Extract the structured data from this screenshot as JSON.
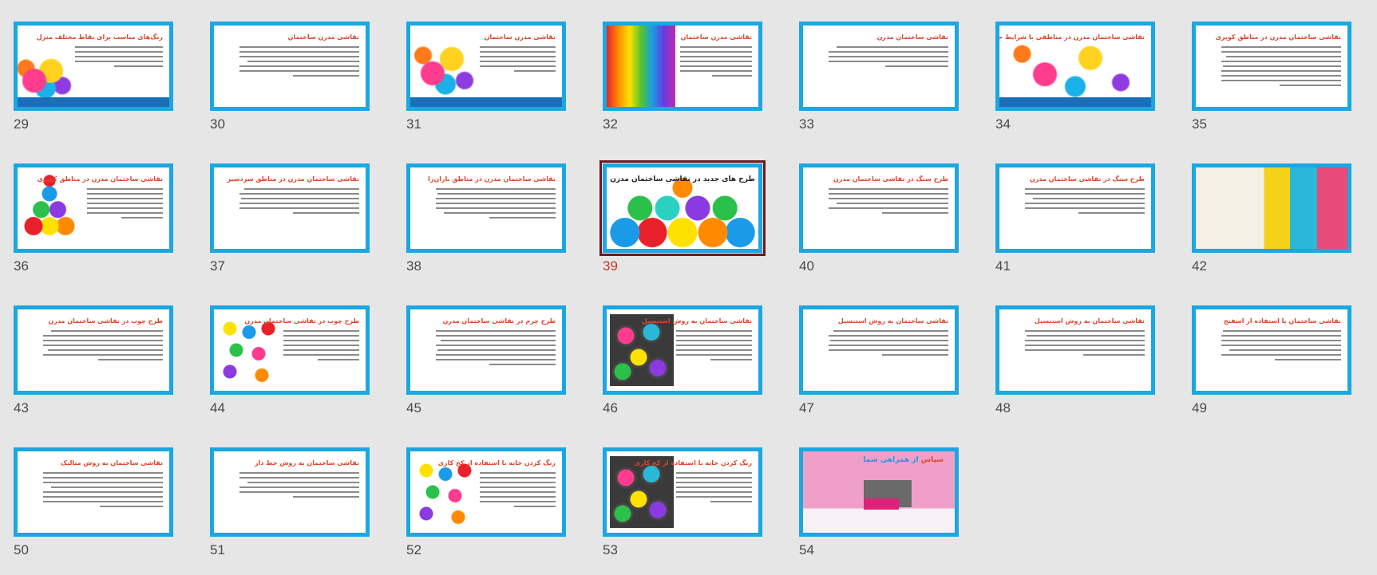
{
  "app": "Slide Sorter",
  "slides": [
    {
      "num": "29",
      "title": "رنگ‌های مناسب برای نقاط مختلف منزل",
      "img": "splash",
      "imgSide": "left-bottom",
      "lines": 5,
      "banner": true
    },
    {
      "num": "30",
      "title": "نقاشی مدرن ساختمان",
      "img": "",
      "lines": 7
    },
    {
      "num": "31",
      "title": "نقاشی مدرن ساختمان",
      "img": "splash",
      "imgSide": "left",
      "lines": 6,
      "banner": true
    },
    {
      "num": "32",
      "title": "نقاشی مدرن ساختمان",
      "img": "feathers",
      "imgSide": "left-full",
      "lines": 7
    },
    {
      "num": "33",
      "title": "نقاشی ساختمان مدرن",
      "img": "",
      "lines": 5
    },
    {
      "num": "34",
      "title": "نقاشی ساختمان مدرن در مناطقی با شرایط جوی مختلف",
      "img": "splash",
      "imgSide": "full",
      "lines": 0,
      "banner": true
    },
    {
      "num": "35",
      "title": "نقاشی ساختمان مدرن در مناطق کویری",
      "img": "",
      "lines": 9
    },
    {
      "num": "36",
      "title": "نقاشی ساختمان مدرن در مناطق کویری",
      "img": "balls",
      "imgSide": "left",
      "lines": 7
    },
    {
      "num": "37",
      "title": "نقاشی ساختمان مدرن در مناطق سردسیر",
      "img": "",
      "lines": 6
    },
    {
      "num": "38",
      "title": "نقاشی ساختمان مدرن در مناطق باران‌زا",
      "img": "",
      "lines": 7
    },
    {
      "num": "39",
      "title": "طرح های جدید در نقاشی ساختمان مدرن",
      "img": "balls2",
      "imgSide": "full",
      "lines": 0,
      "selected": true
    },
    {
      "num": "40",
      "title": "طرح سنگ در نقاشی ساختمان مدرن",
      "img": "",
      "lines": 6
    },
    {
      "num": "41",
      "title": "طرح سنگ در نقاشی ساختمان مدرن",
      "img": "",
      "lines": 6
    },
    {
      "num": "42",
      "title": "",
      "img": "room",
      "imgSide": "full",
      "lines": 0
    },
    {
      "num": "43",
      "title": "طرح چوب در نقاشی ساختمان مدرن",
      "img": "",
      "lines": 7
    },
    {
      "num": "44",
      "title": "طرح چوب در نقاشی ساختمان مدرن",
      "img": "drops",
      "imgSide": "left",
      "lines": 7
    },
    {
      "num": "45",
      "title": "طرح چرم در نقاشی ساختمان مدرن",
      "img": "",
      "lines": 8
    },
    {
      "num": "46",
      "title": "نقاشی ساختمان به روش استنسیل",
      "img": "cans",
      "imgSide": "left",
      "lines": 7
    },
    {
      "num": "47",
      "title": "نقاشی ساختمان به روش استنسیل",
      "img": "",
      "lines": 6
    },
    {
      "num": "48",
      "title": "نقاشی ساختمان به روش استنسیل",
      "img": "",
      "lines": 6
    },
    {
      "num": "49",
      "title": "نقاشی ساختمان با استفاده از اسفنج",
      "img": "",
      "lines": 7
    },
    {
      "num": "50",
      "title": "نقاشی ساختمان به روش متالیک",
      "img": "",
      "lines": 8
    },
    {
      "num": "51",
      "title": "نقاشی ساختمان به روش خط دار",
      "img": "",
      "lines": 6
    },
    {
      "num": "52",
      "title": "رنگ کردن خانه با استفاده از کج کاری",
      "img": "drops",
      "imgSide": "left",
      "lines": 8
    },
    {
      "num": "53",
      "title": "رنگ کردن خانه با استفاده از کج کاری",
      "img": "cans",
      "imgSide": "left",
      "lines": 7
    },
    {
      "num": "54",
      "title": "سپاس از همراهی شما",
      "img": "pinkroom",
      "imgSide": "full",
      "lines": 0,
      "thanks": true
    }
  ],
  "thanks_parts": {
    "a": "سپاس",
    "b": " از ",
    "c": "همراهی شما"
  },
  "colors": {
    "slide_border": "#1aa7e2",
    "title": "#e0452a",
    "selected": "#6e1a1f",
    "selected_num": "#c43a2a",
    "background": "#e6e6e6"
  }
}
